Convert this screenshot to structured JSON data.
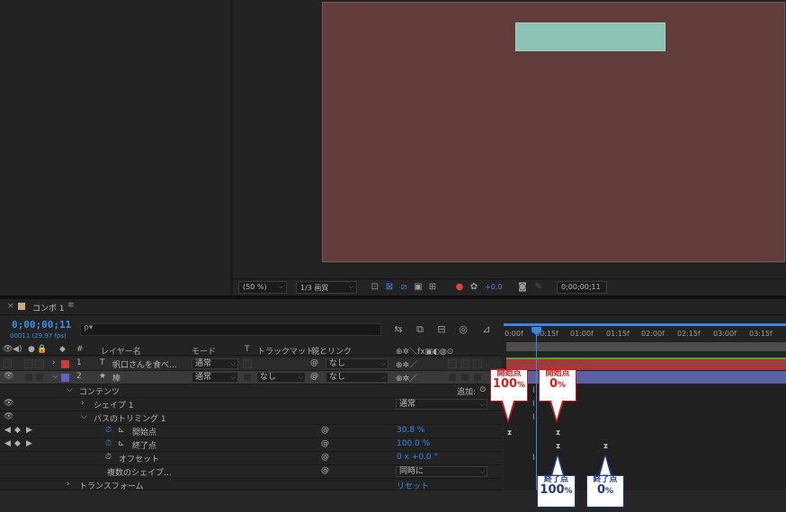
{
  "viewer": {
    "zoom": "(50 %)",
    "resolution": "1/3 画質",
    "exposure": "+0.0",
    "timecode": "0;00;00;11"
  },
  "timeline": {
    "tab_title": "コンポ 1",
    "timecode": "0;00;00;11",
    "timecode_sub": "00011 (29.97 fps)",
    "search_placeholder": "ρ▾"
  },
  "columns": {
    "layer_name": "レイヤー名",
    "mode": "モード",
    "t": "T",
    "track_matte": "トラックマット",
    "parent": "親とリンク",
    "hash": "#"
  },
  "layers": [
    {
      "num": "1",
      "type_icon": "T",
      "name": "帆口さんを食べ…",
      "mode": "通常",
      "matte": "",
      "parent": "なし",
      "label_color": "#c83c3c"
    },
    {
      "num": "2",
      "type_icon": "★",
      "name": "棒",
      "mode": "通常",
      "matte": "なし",
      "parent": "なし",
      "label_color": "#5d62c4"
    }
  ],
  "props": {
    "contents": "コンテンツ",
    "add": "追加:",
    "shape1": "シェイプ 1",
    "shape1_mode": "通常",
    "trim": "パスのトリミング 1",
    "start": "開始点",
    "start_val": "30.8 %",
    "end": "終了点",
    "end_val": "100.0 %",
    "offset": "オフセット",
    "offset_val": "0 x +0.0 °",
    "multi": "複数のシェイプ…",
    "multi_val": "同時に",
    "transform": "トランスフォーム",
    "reset": "リセット"
  },
  "ruler": {
    "labels": [
      "0:00f",
      "00:15f",
      "01:00f",
      "01:15f",
      "02:00f",
      "02:15f",
      "03:00f",
      "03:15f"
    ]
  },
  "callouts": {
    "c1": {
      "title": "開始点",
      "value": "100",
      "unit": "%"
    },
    "c2": {
      "title": "開始点",
      "value": "0",
      "unit": "%"
    },
    "c3": {
      "title": "終了点",
      "value": "100",
      "unit": "%"
    },
    "c4": {
      "title": "終了点",
      "value": "0",
      "unit": "%"
    }
  },
  "colors": {
    "accent": "#3b86e6",
    "callout_red": "#d02020",
    "callout_navy": "#1f3a8a",
    "comp_bg": "#633c3c",
    "shape_fill": "#8dc3b5"
  }
}
